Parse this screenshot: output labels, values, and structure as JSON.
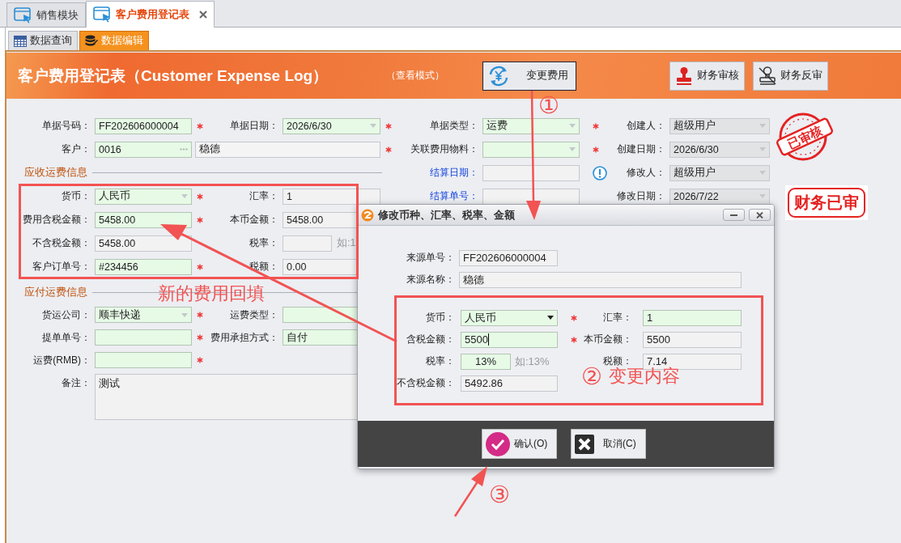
{
  "tabs": [
    {
      "label": "销售模块",
      "selected": false,
      "closable": false
    },
    {
      "label": "客户费用登记表",
      "selected": true,
      "closable": true
    }
  ],
  "subtabs": [
    {
      "label": "数据查询",
      "kind": "grid",
      "selected": false
    },
    {
      "label": "数据编辑",
      "kind": "database",
      "selected": true
    }
  ],
  "header": {
    "title": "客户费用登记表（Customer Expense Log）",
    "mode": "（查看模式）",
    "buttons": [
      {
        "label": "变更费用",
        "kind": "exchange",
        "focused": true
      },
      {
        "label": "财务审核",
        "kind": "stamp",
        "focused": false
      },
      {
        "label": "财务反审",
        "kind": "unstamp",
        "focused": false
      }
    ]
  },
  "form": {
    "rows": [
      [
        {
          "kind": "text",
          "label": "单据号码：",
          "value": "FF202606000004",
          "editable": true,
          "required": true,
          "emphasized": false,
          "info": false
        },
        {
          "kind": "dropdown",
          "label": "单据日期：",
          "value": "2026/6/30",
          "editable": true,
          "required": true,
          "emphasized": false,
          "info": false
        },
        {
          "kind": "dropdown",
          "label": "单据类型：",
          "value": "运费",
          "editable": true,
          "required": true,
          "emphasized": false,
          "info": false
        },
        {
          "kind": "dropdown",
          "label": "创建人：",
          "value": "超级用户",
          "editable": false,
          "required": false,
          "emphasized": false,
          "info": false
        }
      ],
      [
        {
          "kind": "lookup",
          "label": "客户：",
          "value": "0016",
          "name": "稳德",
          "editable": true,
          "required": true,
          "emphasized": false,
          "info": false
        },
        {
          "kind": "dropdown",
          "label": "关联费用物料：",
          "editable": true,
          "required": true,
          "emphasized": false,
          "info": false
        },
        {
          "kind": "dropdown",
          "label": "创建日期：",
          "value": "2026/6/30",
          "editable": false,
          "required": false,
          "emphasized": false,
          "info": false
        }
      ],
      [
        {
          "kind": "section",
          "label": "应收运费信息"
        },
        {
          "kind": "text",
          "label": "结算日期：",
          "editable": false,
          "required": false,
          "emphasized": true,
          "info": true
        },
        {
          "kind": "dropdown",
          "label": "修改人：",
          "value": "超级用户",
          "editable": false,
          "required": false,
          "emphasized": false,
          "info": false
        }
      ],
      [
        {
          "kind": "dropdown",
          "label": "货币：",
          "value": "人民币",
          "editable": true,
          "required": true,
          "emphasized": false,
          "info": false
        },
        {
          "kind": "text",
          "label": "汇率：",
          "value": "1",
          "editable": false,
          "required": false,
          "emphasized": false,
          "info": false
        },
        {
          "kind": "text",
          "label": "结算单号：",
          "editable": false,
          "required": false,
          "emphasized": true,
          "info": false
        },
        {
          "kind": "dropdown",
          "label": "修改日期：",
          "value": "2026/7/22",
          "editable": false,
          "required": false,
          "emphasized": false,
          "info": false
        }
      ],
      [
        {
          "kind": "text",
          "label": "费用含税金额：",
          "value": "5458.00",
          "editable": true,
          "required": true,
          "emphasized": false,
          "info": false
        },
        {
          "kind": "text",
          "label": "本币金额：",
          "value": "5458.00",
          "editable": false,
          "required": false,
          "emphasized": false,
          "info": false
        }
      ],
      [
        {
          "kind": "text",
          "label": "不含税金额：",
          "value": "5458.00",
          "editable": false,
          "required": false,
          "emphasized": false,
          "info": false
        },
        {
          "kind": "hinted",
          "label": "税率：",
          "hint": "如:1",
          "editable": false,
          "required": false,
          "emphasized": false,
          "info": false
        }
      ],
      [
        {
          "kind": "text",
          "label": "客户订单号：",
          "value": "#234456",
          "editable": true,
          "required": true,
          "emphasized": false,
          "info": false
        },
        {
          "kind": "text",
          "label": "税额：",
          "value": "0.00",
          "editable": false,
          "required": false,
          "emphasized": false,
          "info": false
        }
      ],
      [
        {
          "kind": "section",
          "label": "应付运费信息"
        }
      ],
      [
        {
          "kind": "dropdown",
          "label": "货运公司：",
          "value": "顺丰快递",
          "editable": true,
          "required": true,
          "emphasized": false,
          "info": false
        },
        {
          "kind": "text",
          "label": "运费类型：",
          "editable": true,
          "required": false,
          "emphasized": false,
          "info": false
        }
      ],
      [
        {
          "kind": "text",
          "label": "提单单号：",
          "editable": true,
          "required": true,
          "emphasized": false,
          "info": false
        },
        {
          "kind": "text",
          "label": "费用承担方式：",
          "value": "自付",
          "editable": true,
          "required": false,
          "emphasized": false,
          "info": false
        }
      ],
      [
        {
          "kind": "text",
          "label": "运费(RMB)：",
          "editable": true,
          "required": true,
          "emphasized": false,
          "info": false
        }
      ],
      [
        {
          "kind": "memo",
          "label": "备注：",
          "value": "测试",
          "editable": false,
          "required": false,
          "emphasized": false,
          "info": false
        }
      ]
    ]
  },
  "stamps": [
    {
      "kind": "round",
      "text": "已审核"
    },
    {
      "kind": "box",
      "text": "财务已审"
    }
  ],
  "dialog": {
    "title": "修改币种、汇率、税率、金额",
    "source_fields": [
      {
        "label": "来源单号：",
        "value": "FF202606000004",
        "kind": "short"
      },
      {
        "label": "来源名称：",
        "value": "稳德",
        "kind": "wide"
      }
    ],
    "rows": [
      [
        {
          "kind": "dropdown",
          "label": "货币：",
          "value": "人民币",
          "editable": true,
          "required": true,
          "focused": false
        },
        {
          "kind": "text",
          "label": "汇率：",
          "value": "1",
          "editable": true,
          "required": false,
          "focused": false
        }
      ],
      [
        {
          "kind": "text",
          "label": "含税金额：",
          "value": "5500",
          "editable": true,
          "required": true,
          "focused": true
        },
        {
          "kind": "text",
          "label": "本币金额：",
          "value": "5500",
          "editable": false,
          "required": false,
          "focused": false
        }
      ],
      [
        {
          "kind": "hinted",
          "label": "税率：",
          "value": "13%",
          "hint": "如:13%",
          "editable": true,
          "required": false,
          "focused": false
        },
        {
          "kind": "text",
          "label": "税额：",
          "value": "7.14",
          "editable": false,
          "required": false,
          "focused": false
        }
      ],
      [
        {
          "kind": "text",
          "label": "不含税金额：",
          "value": "5492.86",
          "editable": false,
          "required": false,
          "focused": false
        }
      ]
    ],
    "buttons": [
      {
        "label": "确认(O)",
        "kind": "confirm"
      },
      {
        "label": "取消(C)",
        "kind": "cancel"
      }
    ]
  },
  "annotations": [
    {
      "kind": "step",
      "text": "①"
    },
    {
      "kind": "note",
      "text": "新的费用回填"
    },
    {
      "kind": "step",
      "text": "②"
    },
    {
      "kind": "note",
      "text": "变更内容"
    },
    {
      "kind": "step",
      "text": "③"
    }
  ]
}
